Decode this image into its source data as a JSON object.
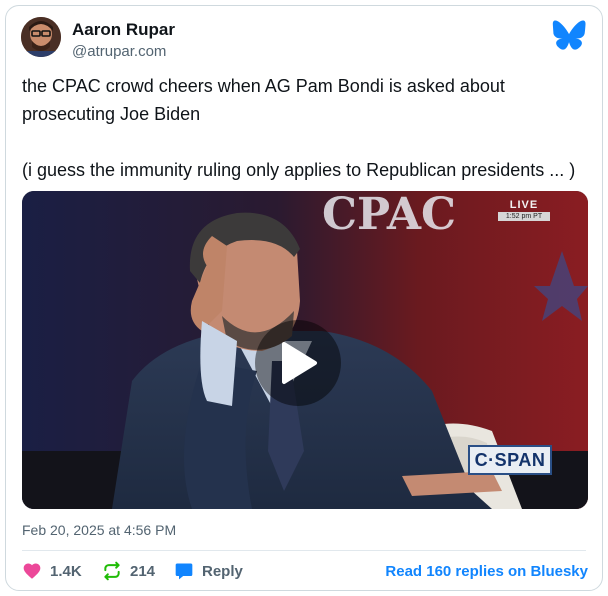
{
  "author": {
    "name": "Aaron Rupar",
    "handle": "@atrupar.com"
  },
  "post": {
    "text": "the CPAC crowd cheers when AG Pam Bondi is asked about\nprosecuting Joe Biden\n\n(i guess the immunity ruling only applies to Republican presidents ... )",
    "timestamp": "Feb 20, 2025 at 4:56 PM"
  },
  "video": {
    "live_label": "LIVE",
    "live_time": "1:52 pm PT",
    "network_logo": "C·SPAN",
    "backdrop_text": "CPAC",
    "play_icon": "play-icon"
  },
  "actions": {
    "likes": "1.4K",
    "reposts": "214",
    "reply_label": "Reply",
    "read_replies_label": "Read 160 replies on Bluesky"
  },
  "colors": {
    "like": "#ec4899",
    "repost": "#20bc07",
    "reply": "#1185fe",
    "link": "#1185fe",
    "bluesky": "#1185fe",
    "muted": "#536471"
  }
}
